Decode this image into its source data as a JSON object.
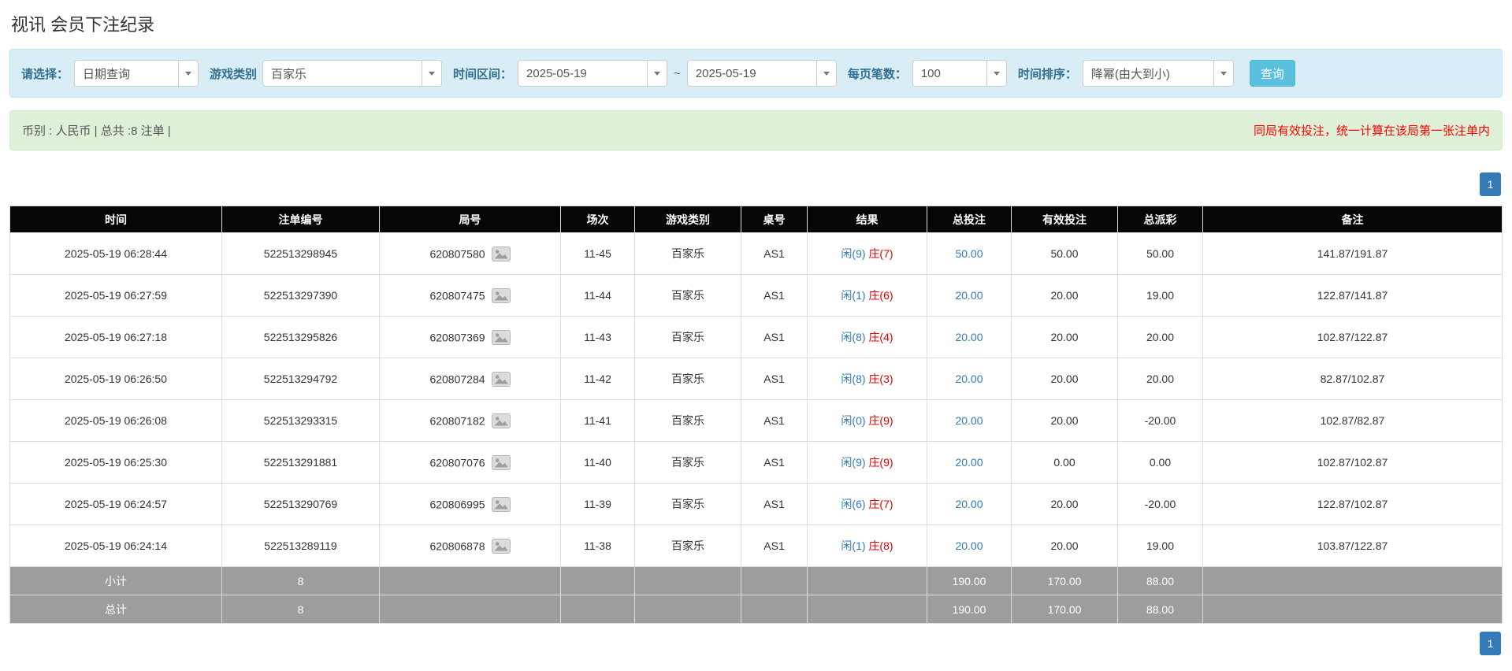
{
  "page": {
    "title": "视讯 会员下注纪录"
  },
  "filters": {
    "select_label": "请选择：",
    "select_value": "日期查询",
    "game_type_label": "游戏类别",
    "game_type_value": "百家乐",
    "time_range_label": "时间区间：",
    "date_from": "2025-05-19",
    "range_separator": "~",
    "date_to": "2025-05-19",
    "per_page_label": "每页笔数：",
    "per_page_value": "100",
    "sort_label": "时间排序：",
    "sort_value": "降幂(由大到小)",
    "query_button_label": "查询"
  },
  "summary": {
    "left_text": "币别 : 人民币 | 总共 :8 注单 |",
    "right_text": "同局有效投注，统一计算在该局第一张注单内"
  },
  "pagination": {
    "current_page": "1"
  },
  "table": {
    "headers": [
      "时间",
      "注单编号",
      "局号",
      "场次",
      "游戏类别",
      "桌号",
      "结果",
      "总投注",
      "有效投注",
      "总派彩",
      "备注"
    ],
    "rows": [
      {
        "time": "2025-05-19 06:28:44",
        "bet_id": "522513298945",
        "round": "620807580",
        "session": "11-45",
        "game": "百家乐",
        "table_no": "AS1",
        "result_player": "闲(9)",
        "result_banker": "庄(7)",
        "total_bet": "50.00",
        "valid_bet": "50.00",
        "payout": "50.00",
        "remark": "141.87/191.87"
      },
      {
        "time": "2025-05-19 06:27:59",
        "bet_id": "522513297390",
        "round": "620807475",
        "session": "11-44",
        "game": "百家乐",
        "table_no": "AS1",
        "result_player": "闲(1)",
        "result_banker": "庄(6)",
        "total_bet": "20.00",
        "valid_bet": "20.00",
        "payout": "19.00",
        "remark": "122.87/141.87"
      },
      {
        "time": "2025-05-19 06:27:18",
        "bet_id": "522513295826",
        "round": "620807369",
        "session": "11-43",
        "game": "百家乐",
        "table_no": "AS1",
        "result_player": "闲(8)",
        "result_banker": "庄(4)",
        "total_bet": "20.00",
        "valid_bet": "20.00",
        "payout": "20.00",
        "remark": "102.87/122.87"
      },
      {
        "time": "2025-05-19 06:26:50",
        "bet_id": "522513294792",
        "round": "620807284",
        "session": "11-42",
        "game": "百家乐",
        "table_no": "AS1",
        "result_player": "闲(8)",
        "result_banker": "庄(3)",
        "total_bet": "20.00",
        "valid_bet": "20.00",
        "payout": "20.00",
        "remark": "82.87/102.87"
      },
      {
        "time": "2025-05-19 06:26:08",
        "bet_id": "522513293315",
        "round": "620807182",
        "session": "11-41",
        "game": "百家乐",
        "table_no": "AS1",
        "result_player": "闲(0)",
        "result_banker": "庄(9)",
        "total_bet": "20.00",
        "valid_bet": "20.00",
        "payout": "-20.00",
        "remark": "102.87/82.87"
      },
      {
        "time": "2025-05-19 06:25:30",
        "bet_id": "522513291881",
        "round": "620807076",
        "session": "11-40",
        "game": "百家乐",
        "table_no": "AS1",
        "result_player": "闲(9)",
        "result_banker": "庄(9)",
        "total_bet": "20.00",
        "valid_bet": "0.00",
        "payout": "0.00",
        "remark": "102.87/102.87"
      },
      {
        "time": "2025-05-19 06:24:57",
        "bet_id": "522513290769",
        "round": "620806995",
        "session": "11-39",
        "game": "百家乐",
        "table_no": "AS1",
        "result_player": "闲(6)",
        "result_banker": "庄(7)",
        "total_bet": "20.00",
        "valid_bet": "20.00",
        "payout": "-20.00",
        "remark": "122.87/102.87"
      },
      {
        "time": "2025-05-19 06:24:14",
        "bet_id": "522513289119",
        "round": "620806878",
        "session": "11-38",
        "game": "百家乐",
        "table_no": "AS1",
        "result_player": "闲(1)",
        "result_banker": "庄(8)",
        "total_bet": "20.00",
        "valid_bet": "20.00",
        "payout": "19.00",
        "remark": "103.87/122.87"
      }
    ],
    "summary_rows": [
      {
        "label": "小计",
        "count": "8",
        "total_bet": "190.00",
        "valid_bet": "170.00",
        "payout": "88.00"
      },
      {
        "label": "总计",
        "count": "8",
        "total_bet": "190.00",
        "valid_bet": "170.00",
        "payout": "88.00"
      }
    ]
  },
  "colors": {
    "accent_blue": "#337ab7",
    "banker_red": "#e60000",
    "negative_red": "#ff0000",
    "filter_bar_bg": "#d9edf7",
    "summary_bar_bg": "#dff0d8",
    "table_header_bg": "#060606",
    "summary_row_bg": "#9d9d9d",
    "query_button_bg": "#5bc0de"
  }
}
